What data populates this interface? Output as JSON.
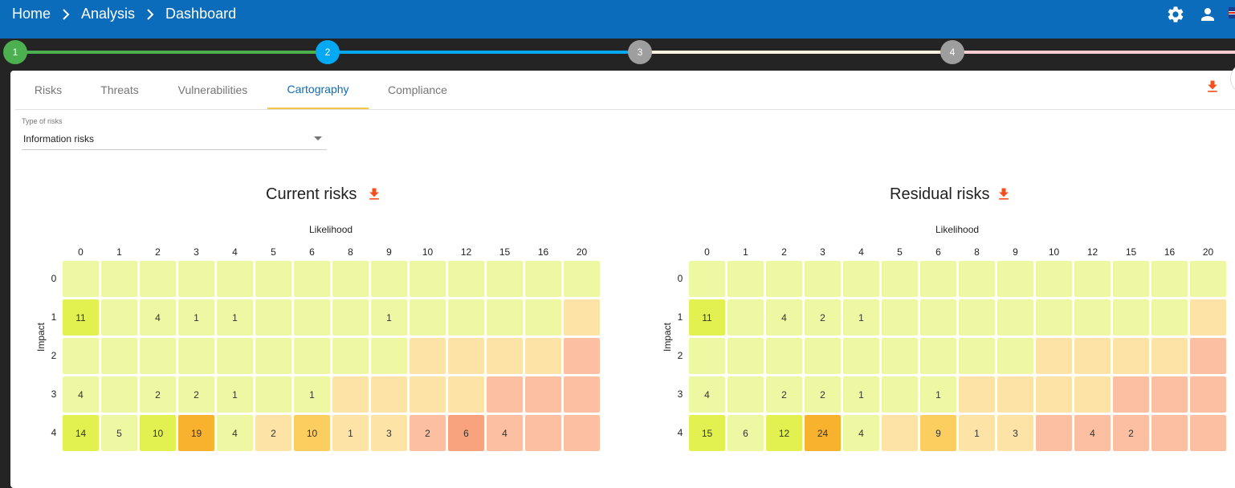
{
  "breadcrumb": [
    "Home",
    "Analysis",
    "Dashboard"
  ],
  "top_icons": [
    "gear-icon",
    "user-icon",
    "uk-flag-icon"
  ],
  "steps": [
    {
      "label": "1",
      "color": "#4caf50",
      "line_color": "#4caf50"
    },
    {
      "label": "2",
      "color": "#03a9f4",
      "line_color": "#03a9f4"
    },
    {
      "label": "3",
      "color": "#9e9e9e",
      "line_color": "#fff3e0"
    },
    {
      "label": "4",
      "color": "#9e9e9e",
      "line_color": "#ffcdd2"
    }
  ],
  "tabs": [
    {
      "label": "Risks",
      "active": false
    },
    {
      "label": "Threats",
      "active": false
    },
    {
      "label": "Vulnerabilities",
      "active": false
    },
    {
      "label": "Cartography",
      "active": true
    },
    {
      "label": "Compliance",
      "active": false
    }
  ],
  "filter": {
    "label": "Type of risks",
    "value": "Information risks"
  },
  "colors": {
    "accent": "#0a6cba",
    "download": "#f4511e",
    "levels": [
      "#eef7a1",
      "#fde3a6",
      "#fcbfa1"
    ],
    "count_high": "#f8b22d",
    "count_mid": "#fcce60",
    "count_low": "#e2f14f"
  },
  "chart_data": [
    {
      "type": "heatmap",
      "title": "Current risks",
      "xlabel": "Likelihood",
      "ylabel": "Impact",
      "x_categories": [
        "0",
        "1",
        "2",
        "3",
        "4",
        "5",
        "6",
        "8",
        "9",
        "10",
        "12",
        "15",
        "16",
        "20"
      ],
      "y_categories": [
        "0",
        "1",
        "2",
        "3",
        "4"
      ],
      "counts": [
        [
          null,
          null,
          null,
          null,
          null,
          null,
          null,
          null,
          null,
          null,
          null,
          null,
          null,
          null
        ],
        [
          11,
          null,
          4,
          1,
          1,
          null,
          null,
          null,
          1,
          null,
          null,
          null,
          null,
          null
        ],
        [
          null,
          null,
          null,
          null,
          null,
          null,
          null,
          null,
          null,
          null,
          null,
          null,
          null,
          null
        ],
        [
          4,
          null,
          2,
          2,
          1,
          null,
          1,
          null,
          null,
          null,
          null,
          null,
          null,
          null
        ],
        [
          14,
          5,
          10,
          19,
          4,
          2,
          10,
          1,
          3,
          2,
          6,
          4,
          null,
          null
        ]
      ]
    },
    {
      "type": "heatmap",
      "title": "Residual risks",
      "xlabel": "Likelihood",
      "ylabel": "Impact",
      "x_categories": [
        "0",
        "1",
        "2",
        "3",
        "4",
        "5",
        "6",
        "8",
        "9",
        "10",
        "12",
        "15",
        "16",
        "20"
      ],
      "y_categories": [
        "0",
        "1",
        "2",
        "3",
        "4"
      ],
      "counts": [
        [
          null,
          null,
          null,
          null,
          null,
          null,
          null,
          null,
          null,
          null,
          null,
          null,
          null,
          null
        ],
        [
          11,
          null,
          4,
          2,
          1,
          null,
          null,
          null,
          null,
          null,
          null,
          null,
          null,
          null
        ],
        [
          null,
          null,
          null,
          null,
          null,
          null,
          null,
          null,
          null,
          null,
          null,
          null,
          null,
          null
        ],
        [
          4,
          null,
          2,
          2,
          1,
          null,
          1,
          null,
          null,
          null,
          null,
          null,
          null,
          null
        ],
        [
          15,
          6,
          12,
          24,
          4,
          null,
          9,
          1,
          3,
          null,
          4,
          2,
          null,
          null
        ]
      ]
    }
  ]
}
